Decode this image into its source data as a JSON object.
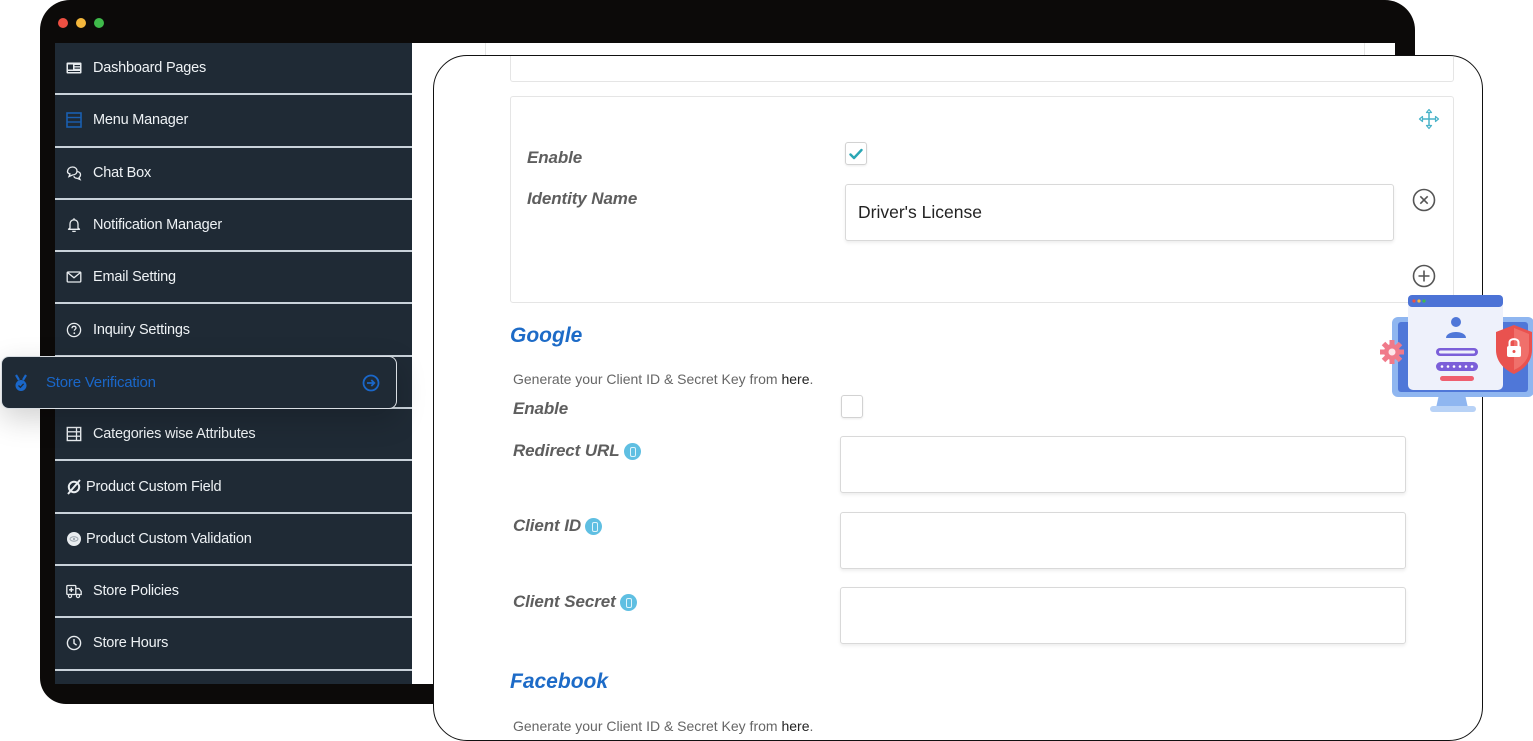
{
  "window": {
    "controls": [
      "close",
      "minimize",
      "maximize"
    ]
  },
  "sidebar": {
    "items": [
      {
        "label": "Dashboard Pages",
        "icon": "id-card-icon"
      },
      {
        "label": "Menu Manager",
        "icon": "menu-list-icon"
      },
      {
        "label": "Chat Box",
        "icon": "chat-bubbles-icon"
      },
      {
        "label": "Notification Manager",
        "icon": "bell-icon"
      },
      {
        "label": "Email Setting",
        "icon": "envelope-icon"
      },
      {
        "label": "Inquiry Settings",
        "icon": "question-circle-icon"
      },
      {
        "label": "Store Verification",
        "icon": "verification-badge-icon",
        "active": true
      },
      {
        "label": "Categories wise Attributes",
        "icon": "table-list-icon"
      },
      {
        "label": "Product Custom Field",
        "icon": "product-field-icon"
      },
      {
        "label": "Product Custom Validation",
        "icon": "validation-eye-icon"
      },
      {
        "label": "Store Policies",
        "icon": "ambulance-icon"
      },
      {
        "label": "Store Hours",
        "icon": "clock-icon"
      }
    ],
    "active_item": {
      "label": "Store Verification",
      "left_icon": "verification-badge-icon",
      "right_icon": "arrow-circle-right-icon",
      "color": "#1a67c9"
    }
  },
  "identity": {
    "enable_label": "Enable",
    "enable_checked": true,
    "name_label": "Identity Name",
    "name_value": "Driver's License",
    "move_icon": "move-arrows-icon",
    "remove_icon": "circle-x-icon",
    "add_icon": "circle-plus-icon"
  },
  "google": {
    "title": "Google",
    "help_prefix": "Generate your Client ID & Secret Key from ",
    "help_link": "here",
    "help_suffix": ".",
    "enable_label": "Enable",
    "enable_checked": false,
    "redirect_label": "Redirect URL",
    "redirect_value": "",
    "client_id_label": "Client ID",
    "client_id_value": "",
    "client_secret_label": "Client Secret",
    "client_secret_value": ""
  },
  "facebook": {
    "title": "Facebook",
    "help_prefix": "Generate your Client ID & Secret Key from ",
    "help_link": "here",
    "help_suffix": "."
  },
  "colors": {
    "sidebar_bg": "#1f2a35",
    "accent_blue": "#1d6bc7",
    "check_teal": "#2aa7b5",
    "info_blue": "#5fbfe2"
  }
}
